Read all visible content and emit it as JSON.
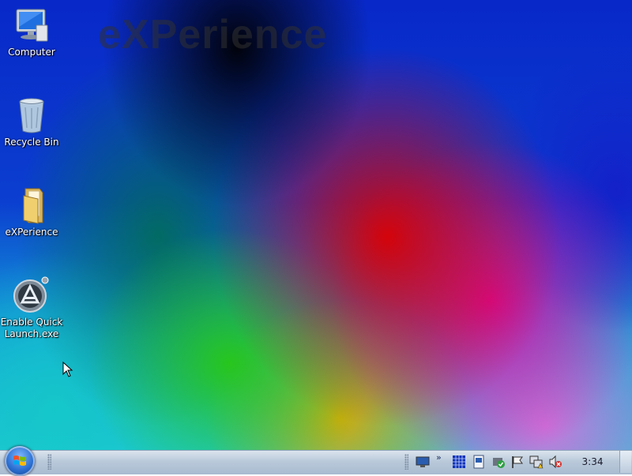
{
  "wallpaper": {
    "watermark": "eXPerience"
  },
  "desktop_icons": [
    {
      "label": "Computer",
      "icon": "computer-icon"
    },
    {
      "label": "Recycle Bin",
      "icon": "recycle-bin-icon"
    },
    {
      "label": "eXPerience",
      "icon": "folder-icon"
    },
    {
      "label": "Enable Quick Launch.exe",
      "icon": "app-shortcut-icon"
    }
  ],
  "taskbar": {
    "start_button": "start-orb-icon",
    "tray": {
      "chevron": "»",
      "clock": "3:34",
      "icons": [
        "monitor-icon",
        "grid-icon",
        "document-icon",
        "security-shield-icon",
        "flag-icon",
        "network-warning-icon",
        "volume-muted-icon"
      ]
    }
  },
  "colors": {
    "desktop_label": "#ffffff",
    "taskbar": "#b9c9da",
    "clock_text": "#1a1a2a"
  }
}
